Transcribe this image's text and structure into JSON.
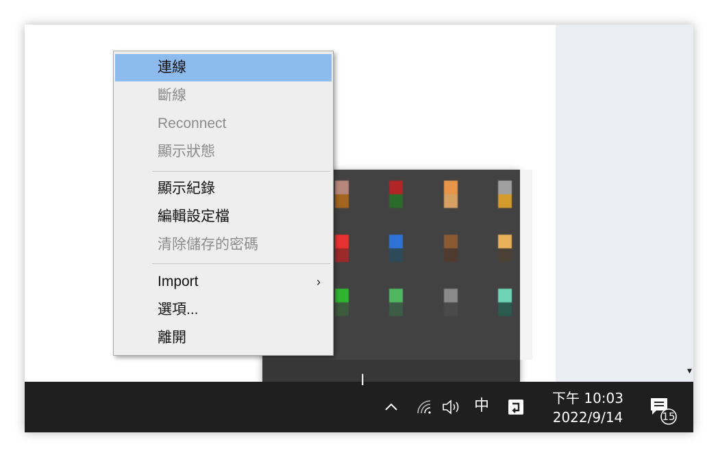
{
  "context_menu": {
    "items": [
      {
        "label": "連線",
        "state": "highlighted"
      },
      {
        "label": "斷線",
        "state": "disabled"
      },
      {
        "label": "Reconnect",
        "state": "disabled"
      },
      {
        "label": "顯示狀態",
        "state": "disabled"
      },
      {
        "label": "顯示紀錄",
        "state": "enabled"
      },
      {
        "label": "編輯設定檔",
        "state": "enabled"
      },
      {
        "label": "清除儲存的密碼",
        "state": "disabled"
      },
      {
        "label": "Import",
        "state": "enabled",
        "submenu_arrow": "›"
      },
      {
        "label": "選項...",
        "state": "enabled"
      },
      {
        "label": "離開",
        "state": "enabled"
      }
    ]
  },
  "tray_overflow": {
    "icons": [
      {
        "name": "tray-icon-1",
        "colors": [
          "#b8877c",
          "#a3651f"
        ]
      },
      {
        "name": "tray-icon-2",
        "colors": [
          "#b02626",
          "#2a6a2a"
        ]
      },
      {
        "name": "tray-icon-3",
        "colors": [
          "#e8964a",
          "#d6a063"
        ]
      },
      {
        "name": "tray-icon-4",
        "colors": [
          "#a0a0a0",
          "#d39b2c"
        ]
      },
      {
        "name": "tray-icon-5",
        "colors": [
          "#e83232",
          "#9d2a2a"
        ]
      },
      {
        "name": "tray-icon-6",
        "colors": [
          "#2e72d6",
          "#2d4a58"
        ]
      },
      {
        "name": "tray-icon-7",
        "colors": [
          "#8a5a35",
          "#4f3a30"
        ]
      },
      {
        "name": "tray-icon-8",
        "colors": [
          "#e9b25a",
          "#4a4035"
        ]
      },
      {
        "name": "tray-icon-9",
        "colors": [
          "#2fb52f",
          "#3c5a3c"
        ]
      },
      {
        "name": "tray-icon-10",
        "colors": [
          "#4fb55f",
          "#3d5c45"
        ]
      },
      {
        "name": "tray-icon-11",
        "colors": [
          "#8a8a8a",
          "#4a4a4a"
        ]
      },
      {
        "name": "tray-icon-12",
        "colors": [
          "#6fd4b4",
          "#2c5a4c"
        ]
      }
    ]
  },
  "taskbar": {
    "ime_label": "中",
    "time": "下午 10:03",
    "date": "2022/9/14",
    "notification_count": "15"
  },
  "colors": {
    "menu_bg": "#eeeeee",
    "menu_highlight": "#8dbbee",
    "disabled_text": "#8c8c8c",
    "taskbar_bg": "#1f1f1f",
    "tray_panel_bg": "#424242"
  }
}
